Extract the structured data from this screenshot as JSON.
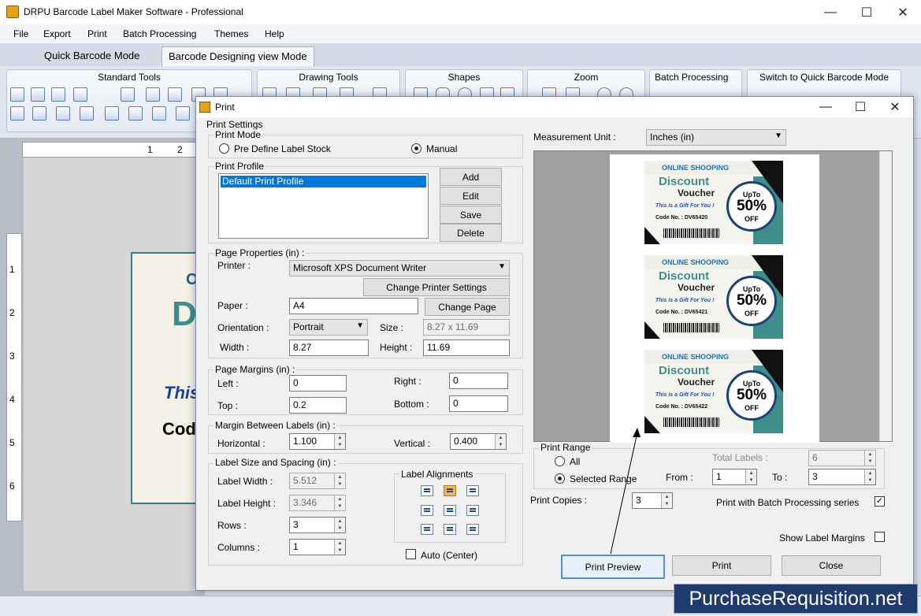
{
  "app": {
    "title": "DRPU Barcode Label Maker Software - Professional"
  },
  "menu": [
    "File",
    "Export",
    "Print",
    "Batch Processing",
    "Themes",
    "Help"
  ],
  "mode_tabs": [
    "Quick Barcode Mode",
    "Barcode Designing view Mode"
  ],
  "ribbon": {
    "groups": [
      "Standard Tools",
      "Drawing Tools",
      "Shapes",
      "Zoom",
      "Batch Processing",
      "Switch to Quick Barcode Mode"
    ]
  },
  "ruler": {
    "h": [
      "1",
      "2"
    ],
    "v": [
      "1",
      "2",
      "3",
      "4",
      "5",
      "6"
    ]
  },
  "canvas_label": {
    "l1": "O",
    "l2": "D",
    "l3": "This",
    "l4": "Cod"
  },
  "dialog": {
    "title": "Print",
    "print_settings": "Print Settings",
    "print_mode": {
      "label": "Print Mode",
      "opt1": "Pre Define Label Stock",
      "opt2": "Manual",
      "selected": "Manual"
    },
    "print_profile": {
      "label": "Print Profile",
      "items": [
        "Default Print Profile"
      ],
      "add": "Add",
      "edit": "Edit",
      "save": "Save",
      "delete": "Delete"
    },
    "page_props": {
      "label": "Page Properties (in) :",
      "printer_label": "Printer :",
      "printer": "Microsoft XPS Document Writer",
      "change_printer": "Change Printer Settings",
      "paper_label": "Paper :",
      "paper": "A4",
      "change_page": "Change Page",
      "orientation_label": "Orientation :",
      "orientation": "Portrait",
      "size_label": "Size :",
      "size": "8.27 x 11.69",
      "width_label": "Width :",
      "width": "8.27",
      "height_label": "Height :",
      "height": "11.69"
    },
    "margins": {
      "label": "Page Margins (in) :",
      "left_label": "Left :",
      "left": "0",
      "right_label": "Right :",
      "right": "0",
      "top_label": "Top :",
      "top": "0.2",
      "bottom_label": "Bottom :",
      "bottom": "0"
    },
    "between": {
      "label": "Margin Between Labels (in) :",
      "h_label": "Horizontal :",
      "h": "1.100",
      "v_label": "Vertical :",
      "v": "0.400"
    },
    "label_size": {
      "label": "Label Size and Spacing (in) :",
      "w_label": "Label Width :",
      "w": "5.512",
      "h_label": "Label Height :",
      "h": "3.346",
      "rows_label": "Rows :",
      "rows": "3",
      "cols_label": "Columns :",
      "cols": "1"
    },
    "alignments": {
      "label": "Label Alignments",
      "auto": "Auto (Center)"
    },
    "measurement": {
      "label": "Measurement Unit :",
      "value": "Inches (in)"
    },
    "preview_labels": [
      {
        "top": "ONLINE SHOOPING",
        "discount": "Discount",
        "voucher": "Voucher",
        "gift": "This is a Gift For You !",
        "code": "Code No. : DV65420",
        "upto": "UpTo",
        "pct": "50%",
        "off": "OFF"
      },
      {
        "top": "ONLINE SHOOPING",
        "discount": "Discount",
        "voucher": "Voucher",
        "gift": "This is a Gift For You !",
        "code": "Code No. : DV65421",
        "upto": "UpTo",
        "pct": "50%",
        "off": "OFF"
      },
      {
        "top": "ONLINE SHOOPING",
        "discount": "Discount",
        "voucher": "Voucher",
        "gift": "This is a Gift For You !",
        "code": "Code No. : DV65422",
        "upto": "UpTo",
        "pct": "50%",
        "off": "OFF"
      }
    ],
    "range": {
      "label": "Print Range",
      "all": "All",
      "selected_range": "Selected Range",
      "total_label": "Total Labels :",
      "total": "6",
      "from_label": "From :",
      "from": "1",
      "to_label": "To :",
      "to": "3"
    },
    "copies": {
      "label": "Print Copies :",
      "value": "3"
    },
    "batch_series": "Print with Batch Processing series",
    "show_margins": "Show Label Margins",
    "buttons": {
      "preview": "Print Preview",
      "print": "Print",
      "close": "Close"
    }
  },
  "watermark": "PurchaseRequisition.net"
}
